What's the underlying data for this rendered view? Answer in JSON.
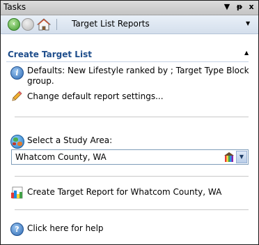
{
  "window": {
    "title": "Tasks",
    "dropdown_glyph": "▼",
    "pin_glyph": "ᵽ",
    "close_glyph": "x"
  },
  "nav": {
    "back_glyph": "‹",
    "forward_glyph": "›",
    "title": "Target List Reports",
    "dropdown_glyph": "▼"
  },
  "section": {
    "title": "Create Target List",
    "collapse_glyph": "▲",
    "defaults_text": "Defaults: New Lifestyle ranked by ; Target Type Block group.",
    "change_defaults_link": "Change default report settings...",
    "study_area_label": "Select a Study Area:",
    "study_area_value": "Whatcom County, WA",
    "create_report_link": "Create Target Report for Whatcom County, WA",
    "help_link": "Click here for help"
  },
  "icons": {
    "back": "back-arrow-icon",
    "forward": "forward-arrow-icon",
    "home": "home-icon",
    "info": "info-icon",
    "pencil": "pencil-icon",
    "globe": "globe-icon",
    "study_area_picker": "color-bars-icon",
    "report": "report-icon",
    "help": "help-icon"
  },
  "colors": {
    "section_title": "#1f4e8c",
    "nav_bg": "#dde7f3",
    "accent": "#2c69b3"
  }
}
